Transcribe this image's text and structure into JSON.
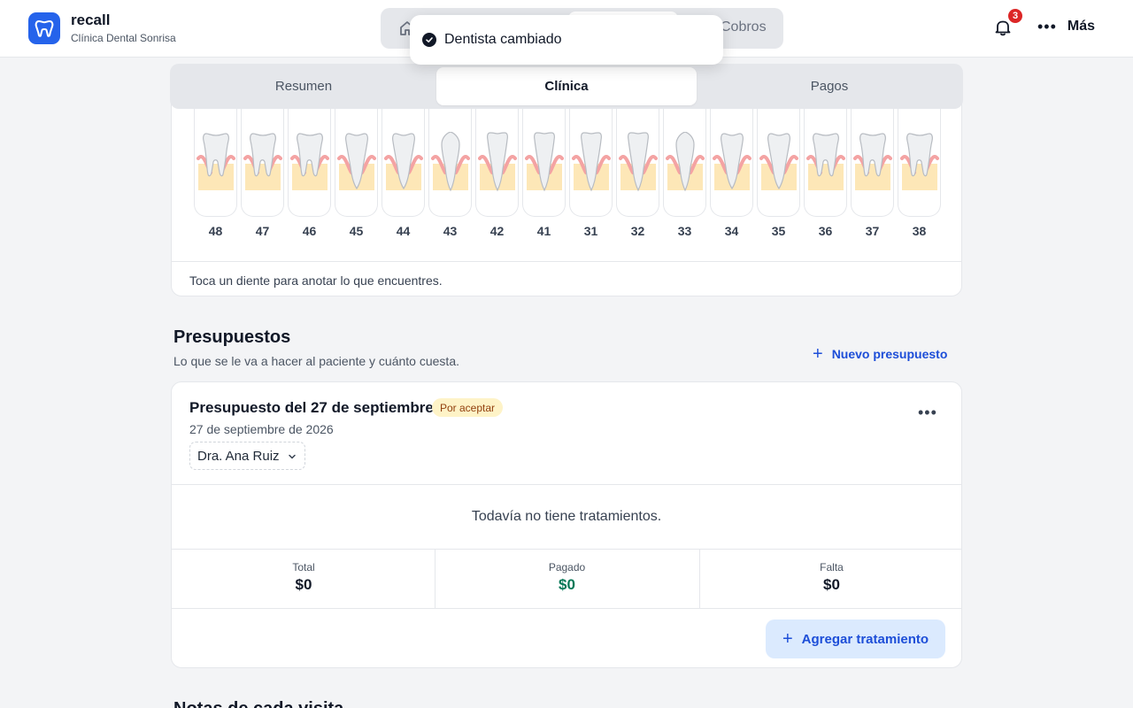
{
  "header": {
    "app_name": "recall",
    "clinic_name": "Clínica Dental Sonrisa",
    "nav": {
      "home_icon": "home-icon",
      "cobros_label": "Cobros"
    },
    "notifications_count": "3",
    "more_label": "Más"
  },
  "toast": {
    "message": "Dentista cambiado"
  },
  "section_tabs": [
    {
      "label": "Resumen",
      "active": false
    },
    {
      "label": "Clínica",
      "active": true
    },
    {
      "label": "Pagos",
      "active": false
    }
  ],
  "odontogram": {
    "teeth": [
      "48",
      "47",
      "46",
      "45",
      "44",
      "43",
      "42",
      "41",
      "31",
      "32",
      "33",
      "34",
      "35",
      "36",
      "37",
      "38"
    ],
    "hint": "Toca un diente para anotar lo que encuentres."
  },
  "budgets": {
    "title": "Presupuestos",
    "subtitle": "Lo que se le va a hacer al paciente y cuánto cuesta.",
    "new_label": "Nuevo presupuesto",
    "card": {
      "title": "Presupuesto del 27 de septiembre",
      "status": "Por aceptar",
      "date": "27 de septiembre de 2026",
      "dentist": "Dra. Ana Ruiz",
      "empty_text": "Todavía no tiene tratamientos.",
      "summary": {
        "total_label": "Total",
        "total_value": "$0",
        "paid_label": "Pagado",
        "paid_value": "$0",
        "due_label": "Falta",
        "due_value": "$0"
      },
      "add_label": "Agregar tratamiento"
    }
  },
  "next_section_title": "Notas de cada visita",
  "colors": {
    "accent": "#2563eb",
    "link": "#1d4ed8",
    "paid": "#047857",
    "badge": "#dc2626",
    "status_bg": "#fef3c7"
  }
}
